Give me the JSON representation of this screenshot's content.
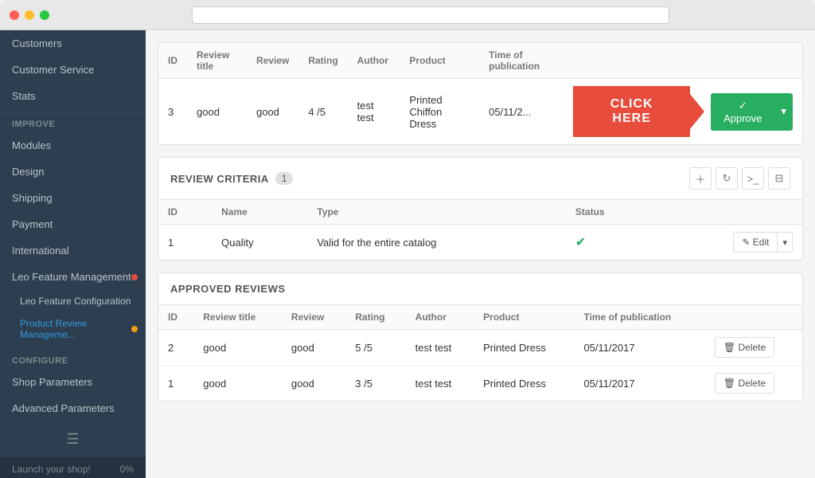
{
  "titlebar": {
    "dots": [
      "red",
      "yellow",
      "green"
    ]
  },
  "sidebar": {
    "section_improve": "IMPROVE",
    "section_configure": "CONFIGURE",
    "items": [
      {
        "label": "Customers",
        "active": false,
        "indent": 0
      },
      {
        "label": "Customer Service",
        "active": false,
        "indent": 0
      },
      {
        "label": "Stats",
        "active": false,
        "indent": 0
      },
      {
        "label": "Modules",
        "active": false,
        "indent": 0
      },
      {
        "label": "Design",
        "active": false,
        "indent": 0
      },
      {
        "label": "Shipping",
        "active": false,
        "indent": 0
      },
      {
        "label": "Payment",
        "active": false,
        "indent": 0
      },
      {
        "label": "International",
        "active": false,
        "indent": 0
      },
      {
        "label": "Leo Feature Management",
        "active": false,
        "indent": 0,
        "badge": "red"
      },
      {
        "label": "Leo Feature Configuration",
        "active": false,
        "indent": 1
      },
      {
        "label": "Product Review Manageme...",
        "active": true,
        "indent": 1,
        "badge": "yellow"
      },
      {
        "label": "Shop Parameters",
        "active": false,
        "indent": 0
      },
      {
        "label": "Advanced Parameters",
        "active": false,
        "indent": 0
      }
    ],
    "launch": "Launch your shop!",
    "progress": "0%"
  },
  "pending_table": {
    "columns": [
      "ID",
      "Review title",
      "Review",
      "Rating",
      "Author",
      "Product",
      "Time of publication"
    ],
    "row": {
      "id": "3",
      "review_title": "good",
      "review": "good",
      "rating": "4 /5",
      "author": "test test",
      "product": "Printed Chiffon Dress",
      "time": "05/11/2..."
    },
    "click_here": "CLICK HERE",
    "approve_label": "✓ Approve"
  },
  "criteria_section": {
    "title": "REVIEW CRITERIA",
    "count": "1",
    "columns": [
      "ID",
      "Name",
      "Type",
      "Status"
    ],
    "row": {
      "id": "1",
      "name": "Quality",
      "type": "Valid for the entire catalog",
      "status": "✓"
    },
    "edit_label": "✎ Edit"
  },
  "approved_section": {
    "title": "APPROVED REVIEWS",
    "columns": [
      "ID",
      "Review title",
      "Review",
      "Rating",
      "Author",
      "Product",
      "Time of publication"
    ],
    "rows": [
      {
        "id": "2",
        "review_title": "good",
        "review": "good",
        "rating": "5 /5",
        "author": "test test",
        "product": "Printed Dress",
        "time": "05/11/2017"
      },
      {
        "id": "1",
        "review_title": "good",
        "review": "good",
        "rating": "3 /5",
        "author": "test test",
        "product": "Printed Dress",
        "time": "05/11/2017"
      }
    ],
    "delete_label": "🗑 Delete"
  }
}
